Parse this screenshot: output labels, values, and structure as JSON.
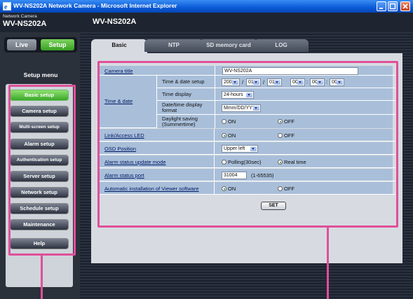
{
  "window": {
    "title": "WV-NS202A Network Camera - Microsoft Internet Explorer"
  },
  "header": {
    "brand_small": "Network Camera",
    "brand_model": "WV-NS202A",
    "page_model": "WV-NS202A"
  },
  "mode": {
    "live": "Live",
    "setup": "Setup"
  },
  "menu": {
    "heading": "Setup menu",
    "items": [
      "Basic setup",
      "Camera setup",
      "Multi-screen setup",
      "Alarm setup",
      "Authentication setup",
      "Server setup",
      "Network setup",
      "Schedule setup",
      "Maintenance",
      "Help"
    ]
  },
  "tabs": [
    "Basic",
    "NTP",
    "SD memory card",
    "LOG"
  ],
  "form": {
    "camera_title_label": "Camera title",
    "camera_title_value": "WV-NS202A",
    "time_date_label": "Time & date",
    "time_date_setup_label": "Time & date setup",
    "year": "2007",
    "month": "01",
    "day": "01",
    "hour": "00",
    "minute": "00",
    "second": "00",
    "time_display_label": "Time display",
    "time_display_value": "24-hours",
    "date_format_label": "Date/time display format",
    "date_format_value": "Mmm/DD/YYYY",
    "daylight_label": "Daylight saving (Summertime)",
    "daylight_on": "ON",
    "daylight_off": "OFF",
    "led_label": "Link/Access LED",
    "led_on": "ON",
    "led_off": "OFF",
    "osd_label": "OSD Position",
    "osd_value": "Upper left",
    "alarm_update_label": "Alarm status update mode",
    "alarm_polling": "Polling(30sec)",
    "alarm_realtime": "Real time",
    "alarm_port_label": "Alarm status port",
    "alarm_port_value": "31004",
    "alarm_port_range": "(1-65535)",
    "viewer_label": "Automatic installation of Viewer software",
    "viewer_on": "ON",
    "viewer_off": "OFF",
    "set_button": "SET"
  },
  "colors": {
    "callout": "#e04f9a",
    "active_green": "#3aa82a",
    "row_blue": "#a9bfd9"
  }
}
